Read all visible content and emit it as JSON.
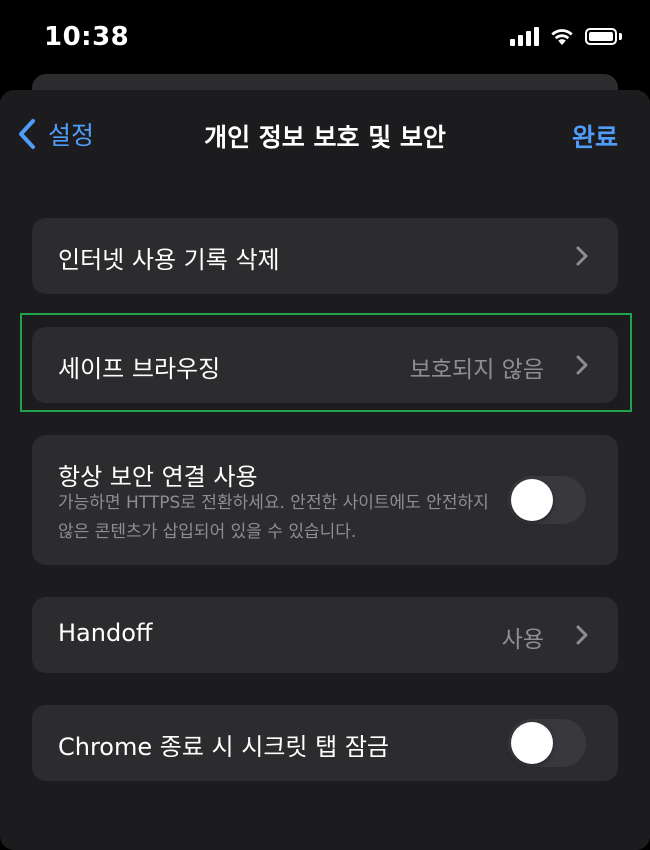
{
  "status_bar": {
    "time": "10:38",
    "icons": [
      "cellular-signal-icon",
      "wifi-icon",
      "battery-icon"
    ]
  },
  "nav": {
    "back_label": "설정",
    "title": "개인 정보 보호 및 보안",
    "done_label": "완료"
  },
  "rows": {
    "clear_history": {
      "label": "인터넷 사용 기록 삭제"
    },
    "safe_browsing": {
      "label": "세이프 브라우징",
      "value": "보호되지 않음"
    },
    "https_always": {
      "label": "항상 보안 연결 사용",
      "subtitle": "가능하면 HTTPS로 전환하세요. 안전한 사이트에도 안전하지 않은 콘텐츠가 삽입되어 있을 수 있습니다.",
      "toggle_on": false
    },
    "handoff": {
      "label": "Handoff",
      "value": "사용"
    },
    "lock_incognito": {
      "label": "Chrome 종료 시 시크릿 탭 잠금",
      "toggle_on": false
    }
  },
  "colors": {
    "background": "#000000",
    "sheet": "#1c1c1e",
    "card": "#2c2c2e",
    "accent": "#4f9df9",
    "secondary_text": "#8d8d93",
    "toggle_off": "#39393d",
    "highlight_border": "#1fa34a"
  }
}
